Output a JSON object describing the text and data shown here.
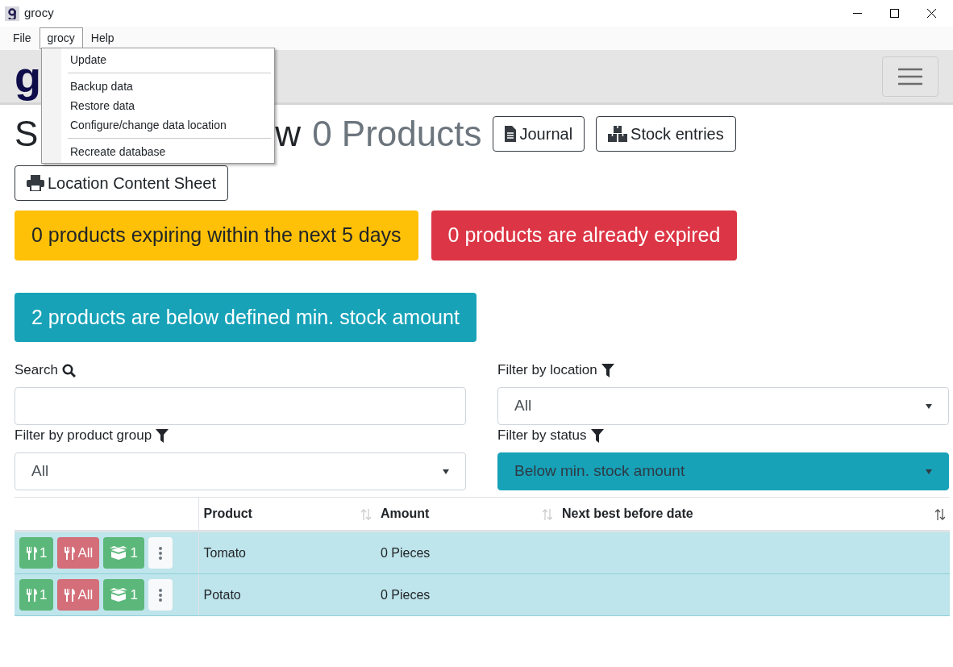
{
  "window": {
    "title": "grocy"
  },
  "menu_bar": [
    {
      "label": "File",
      "selected": false
    },
    {
      "label": "grocy",
      "selected": true
    },
    {
      "label": "Help",
      "selected": false
    }
  ],
  "open_menu": {
    "items": [
      {
        "kind": "item",
        "label": "Update"
      },
      {
        "kind": "separator"
      },
      {
        "kind": "item",
        "label": "Backup data"
      },
      {
        "kind": "item",
        "label": "Restore data"
      },
      {
        "kind": "item",
        "label": "Configure/change data location"
      },
      {
        "kind": "separator"
      },
      {
        "kind": "item",
        "label": "Recreate database"
      }
    ]
  },
  "navbar": {
    "logo": "g"
  },
  "heading": {
    "start": "S",
    "end": "w",
    "count": "0 Products"
  },
  "header_buttons": [
    {
      "kind": "journal",
      "label": "Journal"
    },
    {
      "kind": "entries",
      "label": "Stock entries"
    },
    {
      "kind": "print",
      "label": "Location Content Sheet"
    }
  ],
  "alerts": [
    {
      "kind": "warning",
      "text": "0 products expiring within the next 5 days"
    },
    {
      "kind": "danger",
      "text": "0 products are already expired"
    },
    {
      "kind": "info",
      "text": "2 products are below defined min. stock amount"
    }
  ],
  "filters": [
    {
      "kind": "search",
      "label": "Search"
    },
    {
      "kind": "select",
      "label": "Filter by location",
      "value": "All",
      "highlighted": false
    },
    {
      "kind": "select",
      "label": "Filter by product group",
      "value": "All",
      "highlighted": false
    },
    {
      "kind": "select",
      "label": "Filter by status",
      "value": "Below min. stock amount",
      "highlighted": true
    }
  ],
  "table": {
    "columns": [
      {
        "label": "Product",
        "sorted": false
      },
      {
        "label": "Amount",
        "sorted": false
      },
      {
        "label": "Next best before date",
        "sorted": true
      }
    ],
    "rows": [
      {
        "product": "Tomato",
        "amount": "0 Pieces",
        "actions": [
          {
            "kind": "consume",
            "label": "1"
          },
          {
            "kind": "consume_all",
            "label": "All"
          },
          {
            "kind": "open",
            "label": "1"
          },
          {
            "kind": "more"
          }
        ]
      },
      {
        "product": "Potato",
        "amount": "0 Pieces",
        "actions": [
          {
            "kind": "consume",
            "label": "1"
          },
          {
            "kind": "consume_all",
            "label": "All"
          },
          {
            "kind": "open",
            "label": "1"
          },
          {
            "kind": "more"
          }
        ]
      }
    ]
  }
}
